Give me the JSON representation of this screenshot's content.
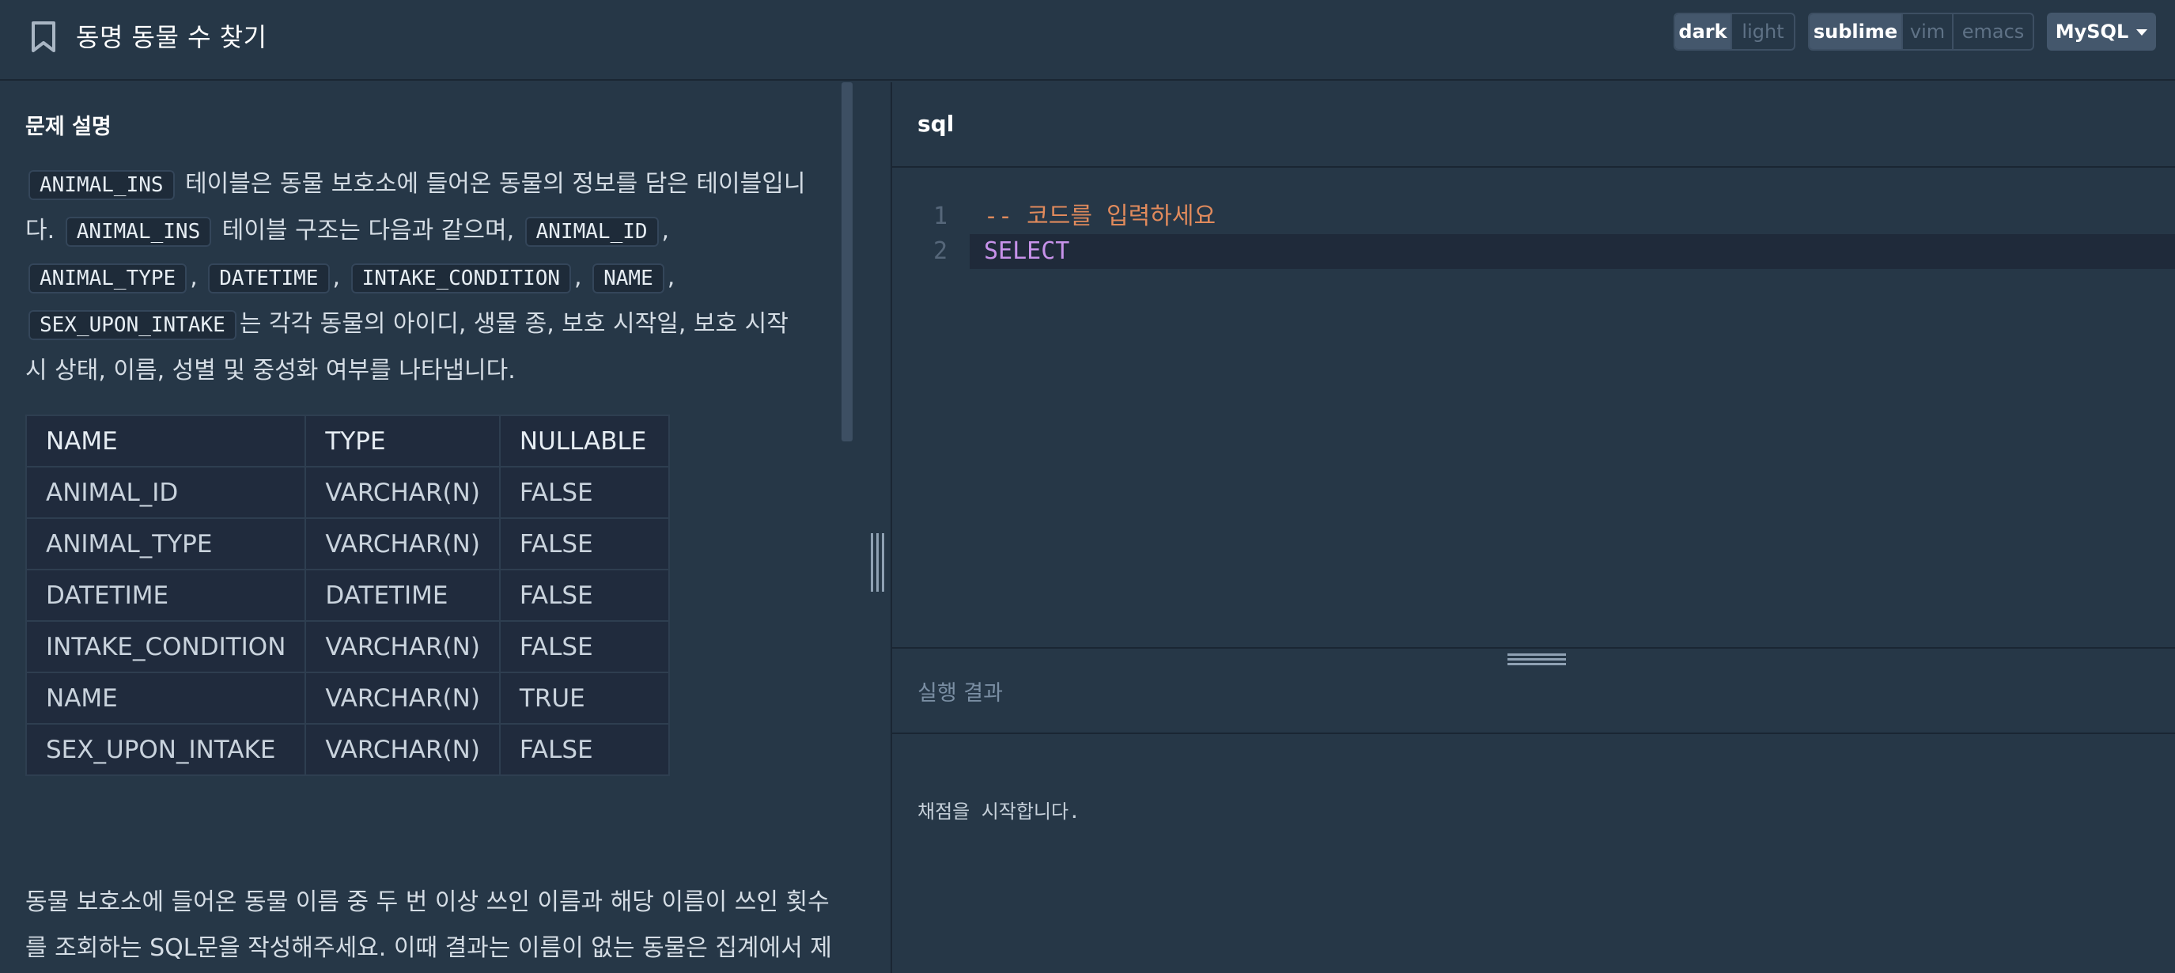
{
  "header": {
    "title": "동명 동물 수 찾기",
    "theme": {
      "options": [
        "dark",
        "light"
      ],
      "selected": "dark"
    },
    "keymap": {
      "options": [
        "sublime",
        "vim",
        "emacs"
      ],
      "selected": "sublime"
    },
    "language": "MySQL"
  },
  "problem": {
    "section_title": "문제 설명",
    "description": [
      {
        "t": "code",
        "v": "ANIMAL_INS"
      },
      {
        "t": "text",
        "v": " 테이블은 동물 보호소에 들어온 동물의 정보를 담은 테이블입니다. "
      },
      {
        "t": "code",
        "v": "ANIMAL_INS"
      },
      {
        "t": "text",
        "v": " 테이블 구조는 다음과 같으며, "
      },
      {
        "t": "code",
        "v": "ANIMAL_ID"
      },
      {
        "t": "text",
        "v": ", "
      },
      {
        "t": "code",
        "v": "ANIMAL_TYPE"
      },
      {
        "t": "text",
        "v": ", "
      },
      {
        "t": "code",
        "v": "DATETIME"
      },
      {
        "t": "text",
        "v": ", "
      },
      {
        "t": "code",
        "v": "INTAKE_CONDITION"
      },
      {
        "t": "text",
        "v": ", "
      },
      {
        "t": "code",
        "v": "NAME"
      },
      {
        "t": "text",
        "v": ", "
      },
      {
        "t": "code",
        "v": "SEX_UPON_INTAKE"
      },
      {
        "t": "text",
        "v": "는 각각 동물의 아이디, 생물 종, 보호 시작일, 보호 시작 시 상태, 이름, 성별 및 중성화 여부를 나타냅니다."
      }
    ],
    "table": {
      "headers": [
        "NAME",
        "TYPE",
        "NULLABLE"
      ],
      "rows": [
        [
          "ANIMAL_ID",
          "VARCHAR(N)",
          "FALSE"
        ],
        [
          "ANIMAL_TYPE",
          "VARCHAR(N)",
          "FALSE"
        ],
        [
          "DATETIME",
          "DATETIME",
          "FALSE"
        ],
        [
          "INTAKE_CONDITION",
          "VARCHAR(N)",
          "FALSE"
        ],
        [
          "NAME",
          "VARCHAR(N)",
          "TRUE"
        ],
        [
          "SEX_UPON_INTAKE",
          "VARCHAR(N)",
          "FALSE"
        ]
      ]
    },
    "task": "동물 보호소에 들어온 동물 이름 중 두 번 이상 쓰인 이름과 해당 이름이 쓰인 횟수를 조회하는 SQL문을 작성해주세요. 이때 결과는 이름이 없는 동물은 집계에서 제외하며, 결과는 이름 순으로 조회해주세요."
  },
  "editor": {
    "label": "sql",
    "lines": [
      {
        "num": "1",
        "text": "-- 코드를 입력하세요",
        "style": "comment"
      },
      {
        "num": "2",
        "text": "SELECT",
        "style": "keyword"
      }
    ]
  },
  "results": {
    "label": "실행 결과",
    "message": "채점을 시작합니다."
  },
  "colors": {
    "background": "#263747",
    "comment": "#e08a5c",
    "keyword": "#c792ea"
  }
}
